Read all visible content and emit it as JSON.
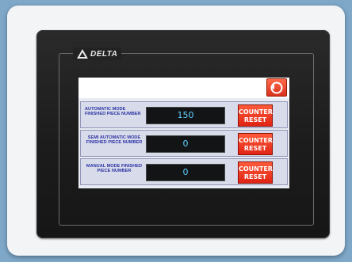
{
  "brand": {
    "name": "DELTA",
    "logo_icon": "delta-triangle-icon"
  },
  "screen": {
    "back_button": {
      "label": "BACK",
      "icon": "return-arrow-icon",
      "color": "#e0321c"
    },
    "rows": [
      {
        "label": "AUTOMATIC MODE FINISHED PIECE NUMBER",
        "value": "150",
        "reset_label": "COUNTER RESET"
      },
      {
        "label": "SEMI AUTOMATIC MODE FINISHED PIECE NUMBER",
        "value": "0",
        "reset_label": "COUNTER RESET"
      },
      {
        "label": "MANUAL MODE FINISHED PIECE NUMBER",
        "value": "0",
        "reset_label": "COUNTER RESET"
      }
    ]
  },
  "colors": {
    "value_text": "#5fd2ff",
    "label_text": "#2d35a5",
    "reset_button": "#e02414",
    "row_background": "#d8dbea"
  }
}
